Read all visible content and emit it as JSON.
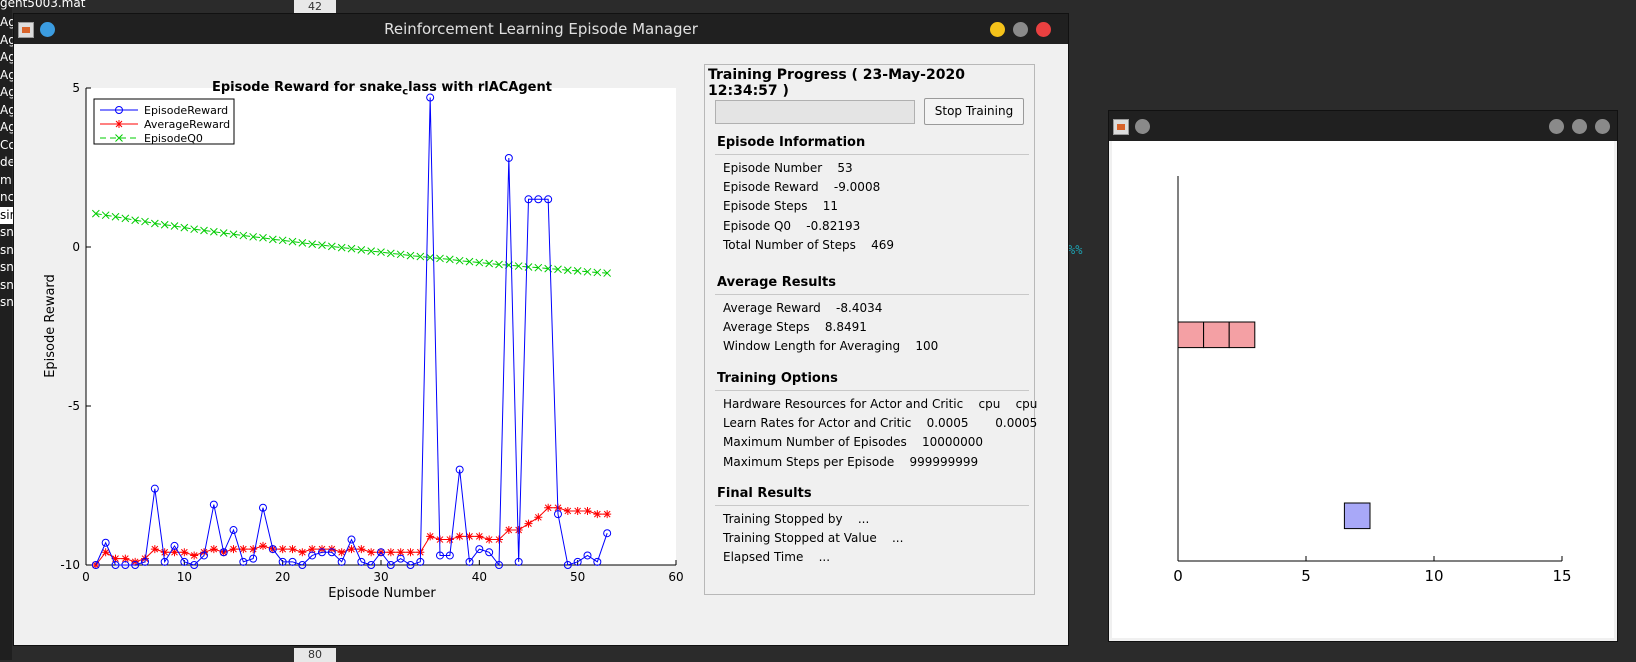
{
  "background": {
    "file_label": "gent5003.mat",
    "list_items": [
      "Ag",
      "Ag",
      "Ag",
      "Ag",
      "Ag",
      "Ag",
      "Ag",
      "Co",
      "de",
      "m",
      "nc",
      "sir",
      "sn",
      "sn",
      "sn",
      "sn",
      "sn"
    ],
    "scroll_top": "42",
    "scroll_bottom": "80",
    "cmd_text": "%%"
  },
  "main_window": {
    "title": "Reinforcement Learning Episode Manager",
    "colors": {
      "close": "#e94040",
      "min": "#f4c21a",
      "max": "#8a8a8a",
      "dot": "#3b9ce0"
    }
  },
  "plot": {
    "title_main": "Episode Reward for snake",
    "title_sub": "c",
    "title_rest": "lass with rlACAgent",
    "xlabel": "Episode Number",
    "ylabel": "Episode Reward",
    "legend": [
      "EpisodeReward",
      "AverageReward",
      "EpisodeQ0"
    ]
  },
  "chart_data": {
    "type": "line",
    "title": "Episode Reward for snake_class with rlACAgent",
    "xlabel": "Episode Number",
    "ylabel": "Episode Reward",
    "xlim": [
      0,
      60
    ],
    "ylim": [
      -10,
      5
    ],
    "xticks": [
      0,
      10,
      20,
      30,
      40,
      50,
      60
    ],
    "yticks": [
      -10,
      -5,
      0,
      5
    ],
    "legend_position": "top-left",
    "x": [
      1,
      2,
      3,
      4,
      5,
      6,
      7,
      8,
      9,
      10,
      11,
      12,
      13,
      14,
      15,
      16,
      17,
      18,
      19,
      20,
      21,
      22,
      23,
      24,
      25,
      26,
      27,
      28,
      29,
      30,
      31,
      32,
      33,
      34,
      35,
      36,
      37,
      38,
      39,
      40,
      41,
      42,
      43,
      44,
      45,
      46,
      47,
      48,
      49,
      50,
      51,
      52,
      53
    ],
    "series": [
      {
        "name": "EpisodeReward",
        "color": "#0000ff",
        "marker": "o",
        "values": [
          -10,
          -9.3,
          -10,
          -10,
          -10,
          -9.9,
          -7.6,
          -9.9,
          -9.4,
          -9.9,
          -10,
          -9.7,
          -8.1,
          -9.6,
          -8.9,
          -9.9,
          -9.8,
          -8.2,
          -9.5,
          -9.9,
          -9.9,
          -10,
          -9.7,
          -9.6,
          -9.6,
          -9.9,
          -9.2,
          -9.9,
          -10,
          -9.6,
          -10,
          -9.8,
          -10,
          -9.9,
          4.7,
          -9.7,
          -9.7,
          -7,
          -9.9,
          -9.5,
          -9.6,
          -10,
          2.8,
          -9.9,
          1.5,
          1.5,
          1.5,
          -8.4,
          -10,
          -9.9,
          -9.7,
          -9.9,
          -9
        ]
      },
      {
        "name": "AverageReward",
        "color": "#ff0000",
        "marker": "*",
        "values": [
          -10,
          -9.6,
          -9.8,
          -9.8,
          -9.9,
          -9.8,
          -9.5,
          -9.6,
          -9.6,
          -9.6,
          -9.7,
          -9.6,
          -9.5,
          -9.6,
          -9.5,
          -9.5,
          -9.5,
          -9.4,
          -9.5,
          -9.5,
          -9.5,
          -9.6,
          -9.5,
          -9.5,
          -9.5,
          -9.6,
          -9.5,
          -9.5,
          -9.6,
          -9.6,
          -9.6,
          -9.6,
          -9.6,
          -9.6,
          -9.1,
          -9.2,
          -9.2,
          -9.1,
          -9.1,
          -9.1,
          -9.2,
          -9.2,
          -8.9,
          -8.9,
          -8.7,
          -8.5,
          -8.2,
          -8.2,
          -8.3,
          -8.3,
          -8.3,
          -8.4,
          -8.4
        ]
      },
      {
        "name": "EpisodeQ0",
        "color": "#00cc00",
        "marker": "x",
        "values": [
          1.05,
          1.0,
          0.95,
          0.9,
          0.84,
          0.8,
          0.74,
          0.7,
          0.66,
          0.61,
          0.56,
          0.52,
          0.48,
          0.44,
          0.4,
          0.36,
          0.32,
          0.29,
          0.24,
          0.21,
          0.17,
          0.13,
          0.09,
          0.06,
          0.02,
          -0.02,
          -0.05,
          -0.09,
          -0.13,
          -0.16,
          -0.2,
          -0.23,
          -0.27,
          -0.3,
          -0.33,
          -0.36,
          -0.39,
          -0.43,
          -0.46,
          -0.49,
          -0.52,
          -0.55,
          -0.57,
          -0.6,
          -0.63,
          -0.65,
          -0.68,
          -0.7,
          -0.73,
          -0.75,
          -0.78,
          -0.8,
          -0.82
        ]
      }
    ]
  },
  "training": {
    "header": "Training Progress ( 23-May-2020 12:34:57 )",
    "stop_label": "Stop Training",
    "sections": [
      {
        "title": "Episode Information",
        "rows": [
          "Episode Number    53",
          "Episode Reward    -9.0008",
          "Episode Steps    11",
          "Episode Q0    -0.82193",
          "Total Number of Steps    469"
        ]
      },
      {
        "title": "Average Results",
        "rows": [
          "Average Reward    -8.4034",
          "Average Steps    8.8491",
          "Window Length for Averaging    100"
        ]
      },
      {
        "title": "Training Options",
        "rows": [
          "Hardware Resources for Actor and Critic    cpu    cpu",
          "Learn Rates for Actor and Critic    0.0005       0.0005",
          "Maximum Number of Episodes    10000000",
          "Maximum Steps per Episode    999999999"
        ]
      },
      {
        "title": "Final Results",
        "rows": [
          "Training Stopped by    ...",
          "Training Stopped at Value    ...",
          "Elapsed Time    ..."
        ]
      }
    ]
  },
  "snake_window": {
    "xticks": [
      "0",
      "5",
      "10",
      "15"
    ],
    "snake_color": "#f4a0a4",
    "food_color": "#a8a8f8",
    "snake_cells": [
      0,
      1,
      2
    ],
    "snake_row": 7,
    "food_cell": [
      7,
      1
    ]
  }
}
